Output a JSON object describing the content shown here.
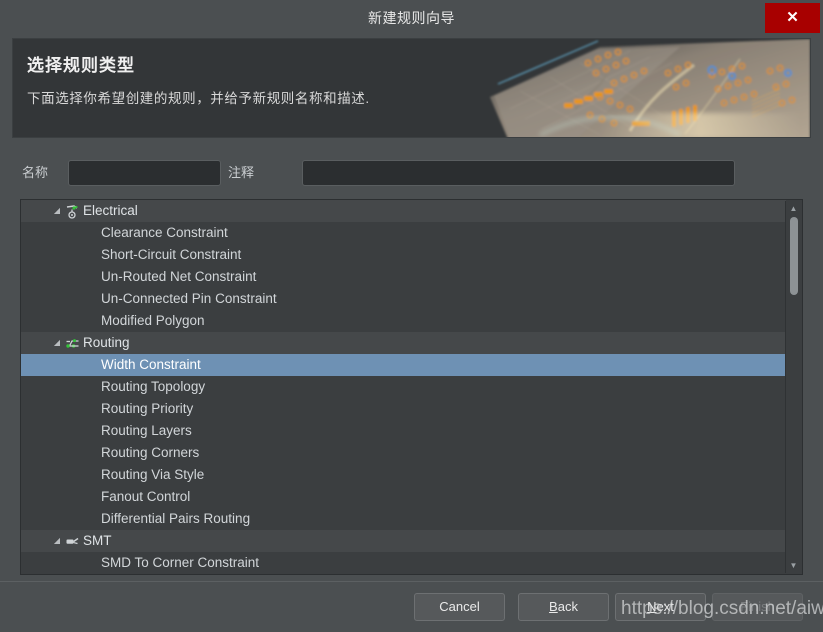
{
  "window": {
    "title": "新建规则向导",
    "close_label": "✕"
  },
  "banner": {
    "title": "选择规则类型",
    "subtitle": "下面选择你希望创建的规则，并给予新规则名称和描述."
  },
  "form": {
    "name_label": "名称",
    "name_value": "",
    "name_placeholder": "",
    "comment_label": "注释",
    "comment_value": "",
    "comment_placeholder": ""
  },
  "tree": {
    "groups": [
      {
        "label": "Electrical",
        "icon": "electrical-icon",
        "expanded": true,
        "items": [
          "Clearance Constraint",
          "Short-Circuit Constraint",
          "Un-Routed Net Constraint",
          "Un-Connected Pin Constraint",
          "Modified Polygon"
        ]
      },
      {
        "label": "Routing",
        "icon": "routing-icon",
        "expanded": true,
        "items": [
          "Width Constraint",
          "Routing Topology",
          "Routing Priority",
          "Routing Layers",
          "Routing Corners",
          "Routing Via Style",
          "Fanout Control",
          "Differential Pairs Routing"
        ]
      },
      {
        "label": "SMT",
        "icon": "smt-icon",
        "expanded": true,
        "items": [
          "SMD To Corner Constraint"
        ]
      }
    ],
    "selected": "Width Constraint",
    "selection_highlight_color": "#6e91b4",
    "selection_outline_color": "#e04a4a",
    "scroll_up_glyph": "▲",
    "scroll_down_glyph": "▼",
    "expand_glyph": "◢"
  },
  "footer": {
    "cancel": "Cancel",
    "back_pre": "",
    "back_mnemonic": "B",
    "back_post": "ack",
    "next_pre": "",
    "next_mnemonic": "N",
    "next_post": "ext",
    "finish": "Finish",
    "finish_disabled": true
  },
  "watermark": {
    "text": "https://blog.csdn.net/aiwr_"
  },
  "colors": {
    "window_bg": "#4b4f51",
    "panel_bg": "#3b3e40",
    "banner_bg": "#333638",
    "input_bg": "#2b2e30",
    "close_red": "#a80000",
    "accent_blue": "#6e91b4"
  }
}
